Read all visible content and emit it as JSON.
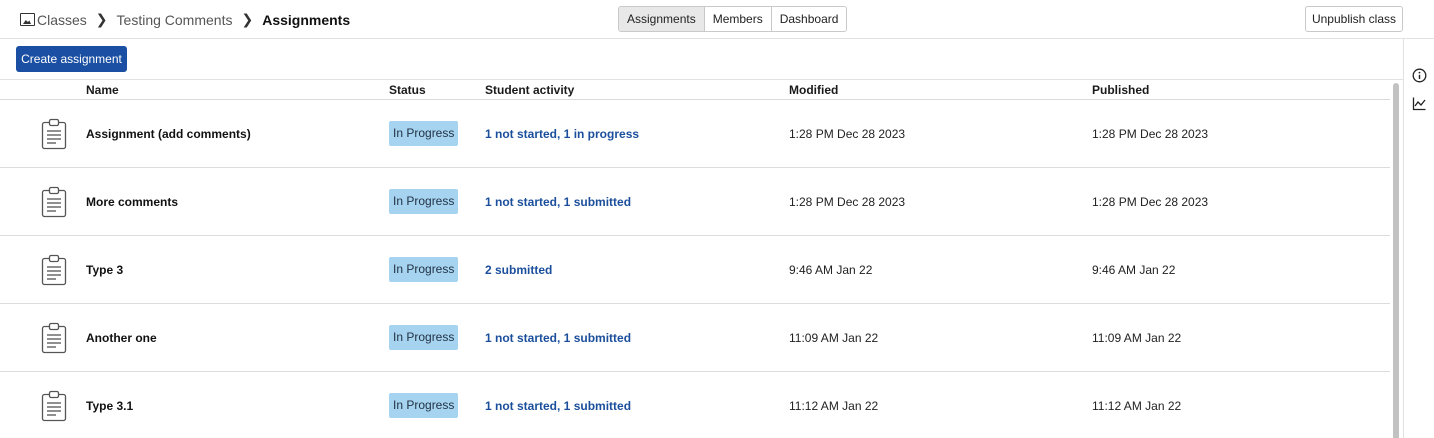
{
  "breadcrumb": {
    "root": "Classes",
    "middle": "Testing Comments",
    "current": "Assignments"
  },
  "tabs": [
    {
      "label": "Assignments",
      "active": true
    },
    {
      "label": "Members",
      "active": false
    },
    {
      "label": "Dashboard",
      "active": false
    }
  ],
  "header_actions": {
    "unpublish_label": "Unpublish class"
  },
  "toolbar": {
    "create_label": "Create assignment"
  },
  "table": {
    "columns": {
      "name": "Name",
      "status": "Status",
      "activity": "Student activity",
      "modified": "Modified",
      "published": "Published"
    },
    "rows": [
      {
        "icon": "clipboard-icon",
        "name": "Assignment (add comments)",
        "status": "In Progress",
        "activity": "1 not started, 1 in progress",
        "modified": "1:28 PM Dec 28 2023",
        "published": "1:28 PM Dec 28 2023"
      },
      {
        "icon": "clipboard-icon",
        "name": "More comments",
        "status": "In Progress",
        "activity": "1 not started, 1 submitted",
        "modified": "1:28 PM Dec 28 2023",
        "published": "1:28 PM Dec 28 2023"
      },
      {
        "icon": "clipboard-icon",
        "name": "Type 3",
        "status": "In Progress",
        "activity": "2 submitted",
        "modified": "9:46 AM Jan 22",
        "published": "9:46 AM Jan 22"
      },
      {
        "icon": "clipboard-icon",
        "name": "Another one",
        "status": "In Progress",
        "activity": "1 not started, 1 submitted",
        "modified": "11:09 AM Jan 22",
        "published": "11:09 AM Jan 22"
      },
      {
        "icon": "clipboard-icon",
        "name": "Type 3.1",
        "status": "In Progress",
        "activity": "1 not started, 1 submitted",
        "modified": "11:12 AM Jan 22",
        "published": "11:12 AM Jan 22"
      }
    ]
  },
  "rail": {
    "icons": [
      "info-icon",
      "chart-icon"
    ]
  },
  "colors": {
    "primary": "#1a4fa3",
    "badge": "#a6d3f0",
    "link": "#1b4f9c"
  }
}
